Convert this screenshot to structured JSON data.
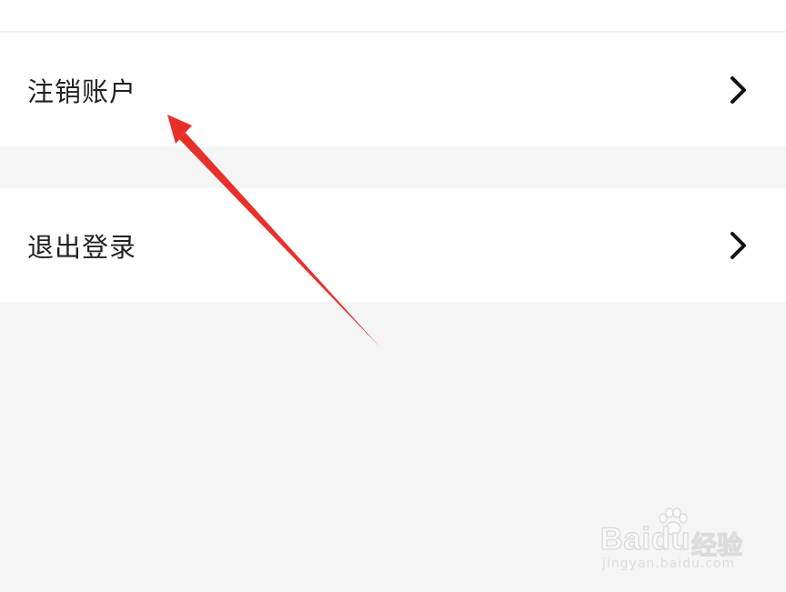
{
  "settings": {
    "items": [
      {
        "label": "注销账户",
        "icon": "chevron-right-icon"
      },
      {
        "label": "退出登录",
        "icon": "chevron-right-icon"
      }
    ]
  },
  "watermark": {
    "brand": "Baidu",
    "brand_cn": "经验",
    "url": "jingyan.baidu.com"
  },
  "colors": {
    "background": "#f5f5f5",
    "row_background": "#ffffff",
    "text": "#222222",
    "annotation_arrow": "#e8302a"
  }
}
